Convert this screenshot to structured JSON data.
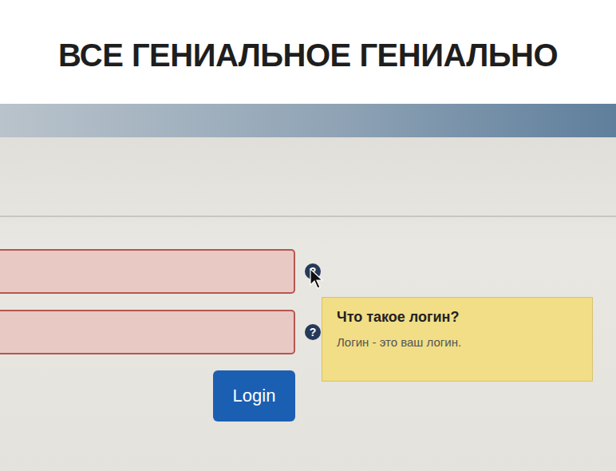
{
  "header": {
    "title": "ВСЕ ГЕНИАЛЬНОЕ ГЕНИАЛЬНО"
  },
  "form": {
    "fields": [
      {
        "help": "?",
        "invalid": true
      },
      {
        "help": "?",
        "invalid": true
      }
    ],
    "button": {
      "label": "Login"
    }
  },
  "tooltip": {
    "title": "Что такое логин?",
    "text": "Логин - это ваш логин."
  }
}
